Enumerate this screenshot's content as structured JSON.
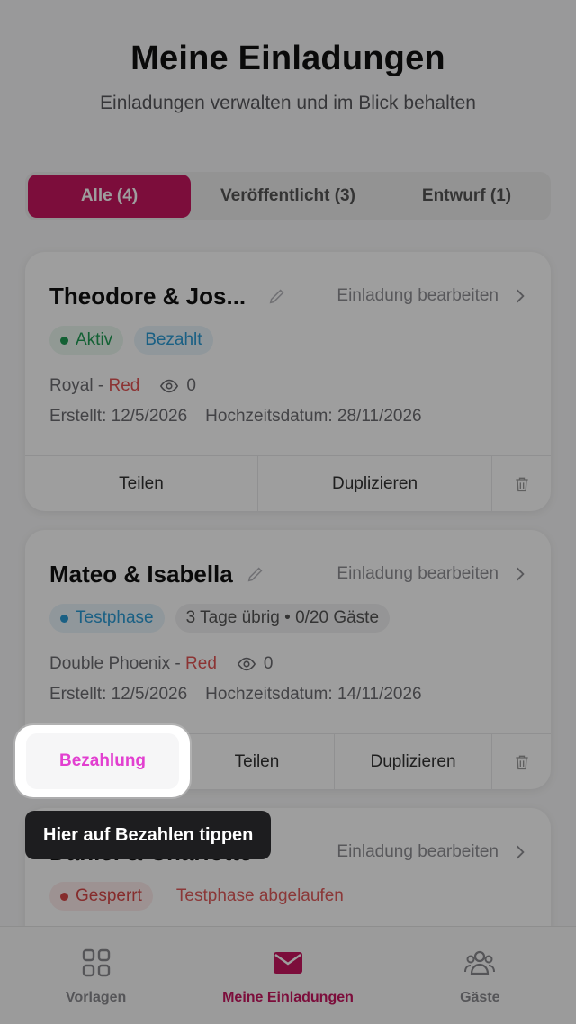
{
  "header": {
    "title": "Meine Einladungen",
    "subtitle": "Einladungen verwalten und im Blick behalten"
  },
  "tabs": [
    {
      "label": "Alle (4)",
      "active": true
    },
    {
      "label": "Veröffentlicht (3)",
      "active": false
    },
    {
      "label": "Entwurf (1)",
      "active": false
    }
  ],
  "cards": [
    {
      "title": "Theodore & Jos...",
      "edit_label": "Einladung bearbeiten",
      "status": "Aktiv",
      "payment": "Bezahlt",
      "theme": "Royal",
      "color": "Red",
      "views": "0",
      "created": "Erstellt: 12/5/2026",
      "wedding_date": "Hochzeitsdatum: 28/11/2026",
      "actions": {
        "share": "Teilen",
        "duplicate": "Duplizieren"
      }
    },
    {
      "title": "Mateo & Isabella",
      "edit_label": "Einladung bearbeiten",
      "status": "Testphase",
      "trial_info": "3 Tage übrig • 0/20 Gäste",
      "theme": "Double Phoenix",
      "color": "Red",
      "views": "0",
      "created": "Erstellt: 12/5/2026",
      "wedding_date": "Hochzeitsdatum: 14/11/2026",
      "actions": {
        "pay": "Bezahlung",
        "share": "Teilen",
        "duplicate": "Duplizieren"
      }
    },
    {
      "title": "Daniel & Charlotte",
      "edit_label": "Einladung bearbeiten",
      "status": "Gesperrt",
      "expired": "Testphase abgelaufen"
    }
  ],
  "tooltip": "Hier auf Bezahlen tippen",
  "nav": [
    {
      "label": "Vorlagen",
      "icon": "grid-icon",
      "active": false
    },
    {
      "label": "Meine Einladungen",
      "icon": "envelope-icon",
      "active": true
    },
    {
      "label": "Gäste",
      "icon": "people-icon",
      "active": false
    }
  ],
  "colors": {
    "accent": "#c8155f",
    "highlight": "#e23fd0"
  }
}
